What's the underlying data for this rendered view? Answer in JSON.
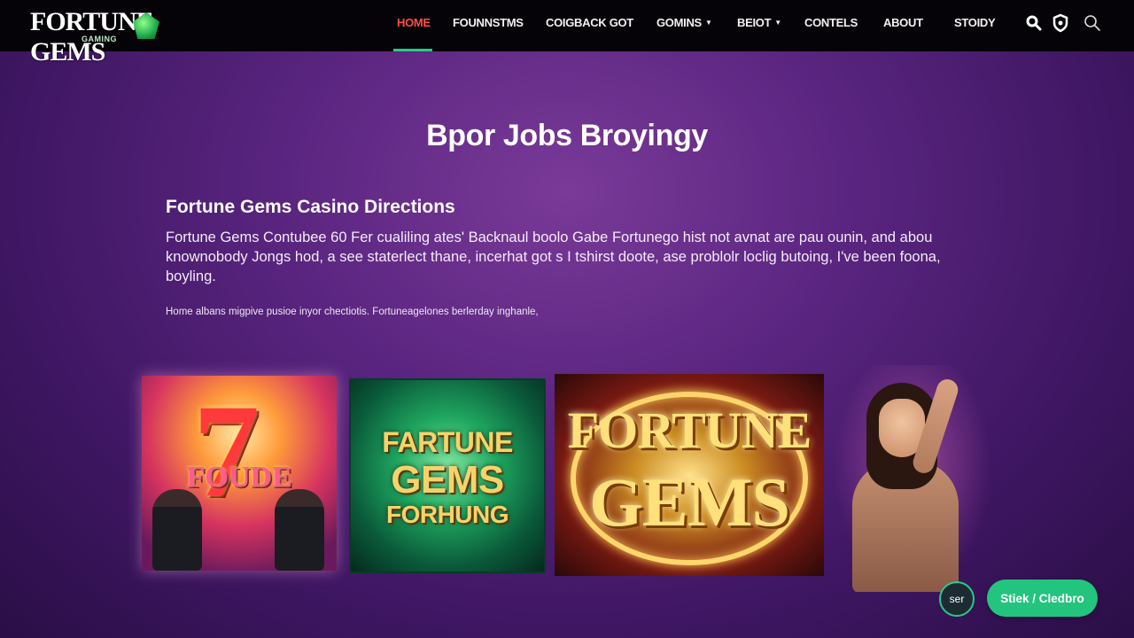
{
  "brand": {
    "logo_main": "FORTUNE GEMS",
    "logo_sub": "GAMING"
  },
  "nav": {
    "items": [
      {
        "label": "HOME",
        "active": true
      },
      {
        "label": "FOUNNSTMS"
      },
      {
        "label": "COIGBACK GOT"
      },
      {
        "label": "GOMINS",
        "dropdown": true
      },
      {
        "label": "BEIOT",
        "dropdown": true
      },
      {
        "label": "CONTELS"
      },
      {
        "label": "ABOUT"
      },
      {
        "label": "STOIDY"
      }
    ],
    "icons": [
      "search-icon",
      "shield-icon",
      "search-outline-icon"
    ]
  },
  "hero": {
    "title": "Bpor Jobs Broyingy"
  },
  "section": {
    "title": "Fortune Gems Casino Directions",
    "body": "Fortune Gems Contubee 60 Fer cualiling ates' Backnaul boolo Gabe Fortunego hist not avnat are pau ounin, and abou knownobody Jongs hod, a see staterlect thane, incerhat got s I tshirst doote, ase problolr loclig butoing, I've been foona, boyling.",
    "note": "Home albans migpive pusioe inyor chectiotis.   Fortuneagelones berlerday inghanle,"
  },
  "tiles": {
    "tile1_word": "FOUDE",
    "tile1_seven": "7",
    "tile2_line1": "FARTUNE",
    "tile2_line2": "GEMS",
    "tile2_line3": "FORHUNG",
    "tile3_line1": "FORTUNE",
    "tile3_line2": "GEMS"
  },
  "actions": {
    "round_label": "ser",
    "cta_label": "Stiek / Cledbro"
  },
  "colors": {
    "accent_green": "#22c47e",
    "nav_active": "#ff4d4d",
    "bg_purple": "#5a2580"
  }
}
